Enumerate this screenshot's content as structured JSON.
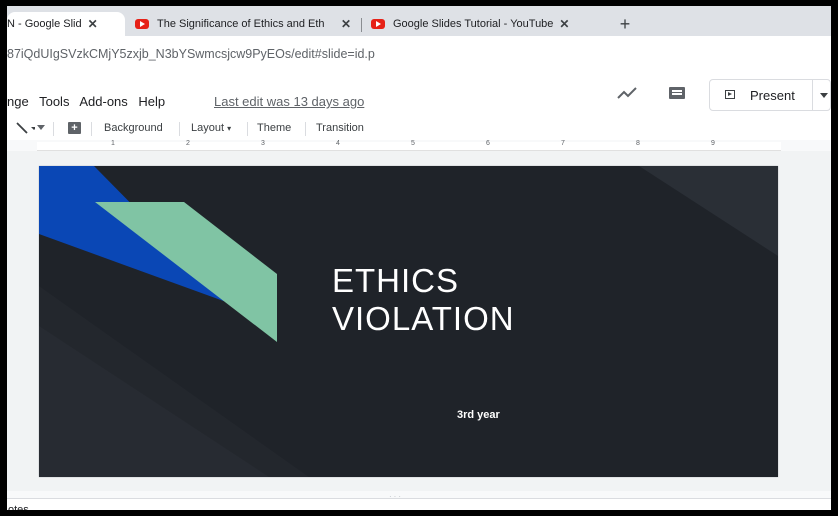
{
  "browser": {
    "tabs": [
      {
        "title": "N - Google Slid",
        "close": "✕"
      },
      {
        "title": "The Significance of Ethics and Eth",
        "close": "✕"
      },
      {
        "title": "Google Slides Tutorial - YouTube",
        "close": "✕"
      }
    ],
    "new_tab": "+",
    "url": "87iQdUIgSVzkCMjY5zxjb_N3bYSwmcsjcw9PyEOs/edit#slide=id.p"
  },
  "menubar": {
    "items": [
      "nge",
      "Tools",
      "Add-ons",
      "Help"
    ],
    "last_edit": "Last edit was 13 days ago"
  },
  "header_actions": {
    "activity_icon": "trending-up-icon",
    "comment_icon": "comment-icon",
    "present_label": "Present"
  },
  "toolbar": {
    "background": "Background",
    "layout": "Layout",
    "theme": "Theme",
    "transition": "Transition"
  },
  "ruler": {
    "numbers": [
      "1",
      "2",
      "3",
      "4",
      "5",
      "6",
      "7",
      "8",
      "9"
    ]
  },
  "slide": {
    "title_line1": "ETHICS",
    "title_line2": "VIOLATION",
    "subtitle": "3rd year",
    "colors": {
      "background": "#1f2329",
      "blue": "#0a47b5",
      "green": "#80c4a4"
    }
  },
  "notes": {
    "label": "otes"
  }
}
